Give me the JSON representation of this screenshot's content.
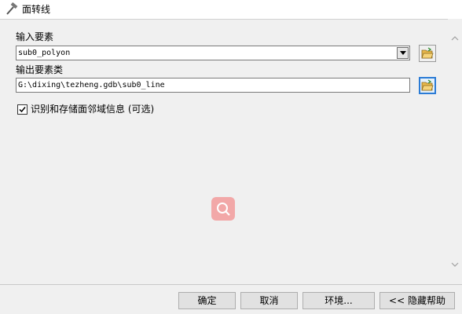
{
  "window": {
    "title": "面转线",
    "icon": "hammer-icon"
  },
  "input_features": {
    "label": "输入要素",
    "value": "sub0_polyon",
    "dropdown_icon": "chevron-down-icon",
    "browse_icon": "open-folder-icon"
  },
  "output_feature_class": {
    "label": "输出要素类",
    "value": "G:\\dixing\\tezheng.gdb\\sub0_line",
    "browse_icon": "open-folder-icon"
  },
  "options": {
    "identify_neighbors": {
      "label": "识别和存储面邻域信息 (可选)",
      "checked": true
    }
  },
  "buttons": {
    "ok": "确定",
    "cancel": "取消",
    "environments": "环境...",
    "hide_help": "<< 隐藏帮助"
  },
  "colors": {
    "focus_border": "#2b7bd5",
    "folder_yellow": "#e8b84a",
    "watermark": "#f2a8a8"
  }
}
